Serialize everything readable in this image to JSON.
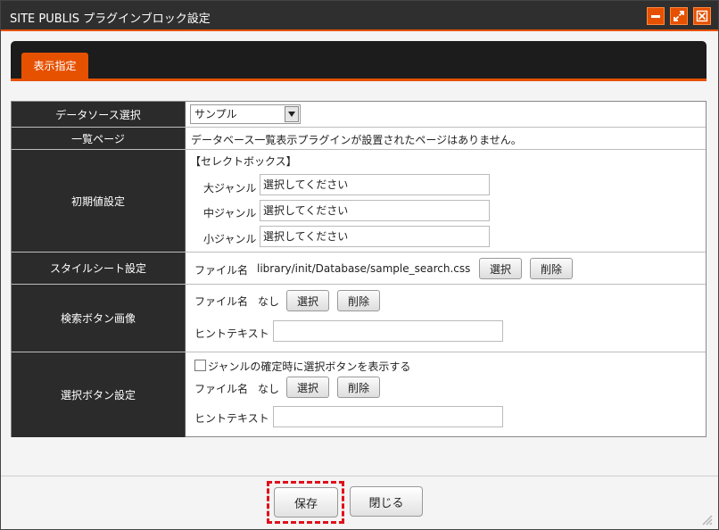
{
  "window": {
    "title": "SITE PUBLIS プラグインブロック設定",
    "controls": {
      "minimize": "minimize-icon",
      "maximize": "maximize-icon",
      "close": "close-icon"
    },
    "accent_color": "#e65100"
  },
  "tabs": [
    {
      "label": "表示指定",
      "active": true
    }
  ],
  "rows": {
    "datasource": {
      "label": "データソース選択",
      "selected": "サンプル"
    },
    "list_page": {
      "label": "一覧ページ",
      "message": "データベース一覧表示プラグインが設置されたページはありません。"
    },
    "initial": {
      "label": "初期値設定",
      "heading": "【セレクトボックス】",
      "fields": [
        {
          "label": "大ジャンル",
          "value": "選択してください"
        },
        {
          "label": "中ジャンル",
          "value": "選択してください"
        },
        {
          "label": "小ジャンル",
          "value": "選択してください"
        }
      ]
    },
    "stylesheet": {
      "label": "スタイルシート設定",
      "file_label": "ファイル名",
      "file": "library/init/Database/sample_search.css",
      "select": "選択",
      "delete": "削除"
    },
    "search_button": {
      "label": "検索ボタン画像",
      "file_label": "ファイル名",
      "file": "なし",
      "select": "選択",
      "delete": "削除",
      "hint_label": "ヒントテキスト",
      "hint": ""
    },
    "select_button": {
      "label": "選択ボタン設定",
      "checkbox_label": "ジャンルの確定時に選択ボタンを表示する",
      "checked": false,
      "file_label": "ファイル名",
      "file": "なし",
      "select": "選択",
      "delete": "削除",
      "hint_label": "ヒントテキスト",
      "hint": ""
    }
  },
  "footer": {
    "save": "保存",
    "close": "閉じる"
  }
}
